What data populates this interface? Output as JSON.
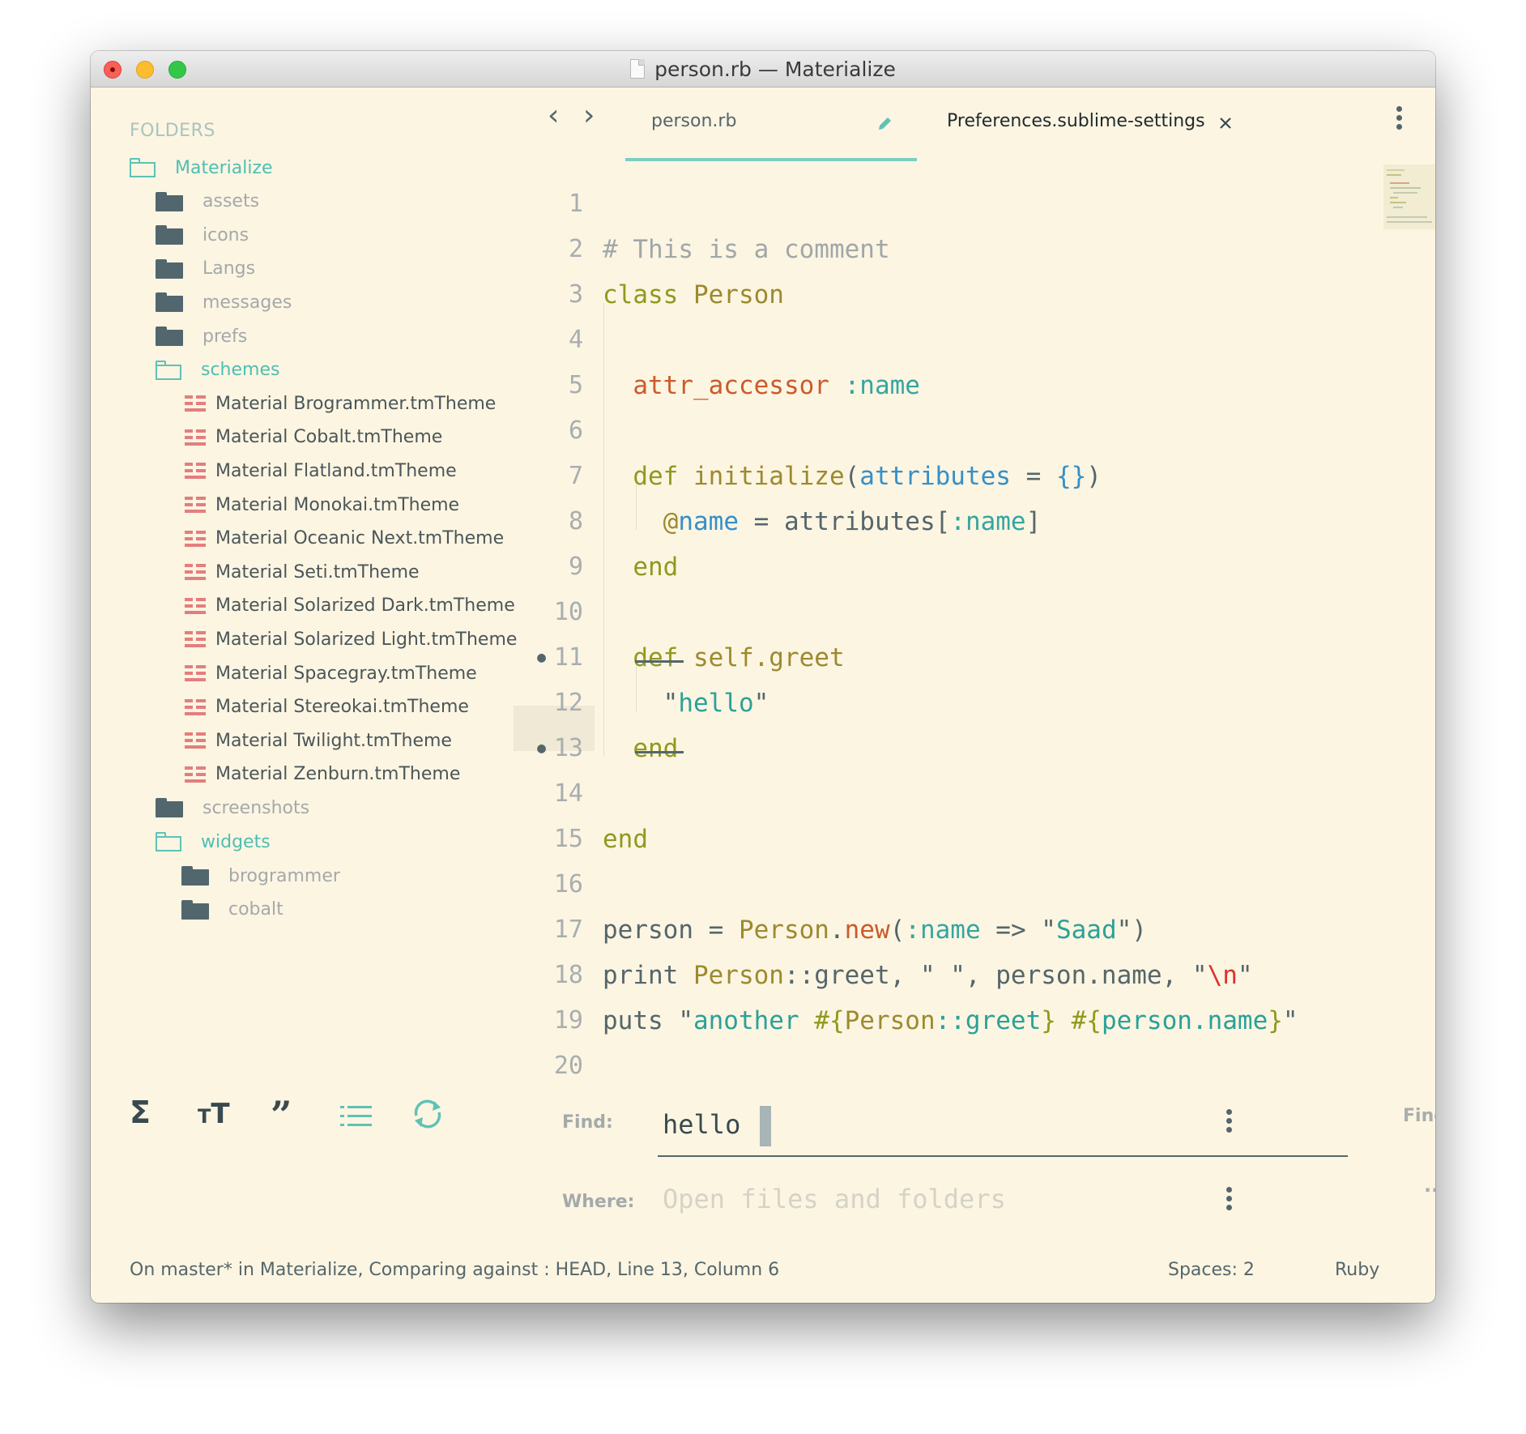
{
  "window": {
    "title": "person.rb — Materialize"
  },
  "sidebar": {
    "header": "FOLDERS",
    "items": [
      {
        "label": "Materialize",
        "kind": "folder-open",
        "depth": 0
      },
      {
        "label": "assets",
        "kind": "folder",
        "depth": 1
      },
      {
        "label": "icons",
        "kind": "folder",
        "depth": 1
      },
      {
        "label": "Langs",
        "kind": "folder",
        "depth": 1
      },
      {
        "label": "messages",
        "kind": "folder",
        "depth": 1
      },
      {
        "label": "prefs",
        "kind": "folder",
        "depth": 1
      },
      {
        "label": "schemes",
        "kind": "folder-open",
        "depth": 1
      },
      {
        "label": "Material Brogrammer.tmTheme",
        "kind": "file",
        "depth": 2
      },
      {
        "label": "Material Cobalt.tmTheme",
        "kind": "file",
        "depth": 2
      },
      {
        "label": "Material Flatland.tmTheme",
        "kind": "file",
        "depth": 2
      },
      {
        "label": "Material Monokai.tmTheme",
        "kind": "file",
        "depth": 2
      },
      {
        "label": "Material Oceanic Next.tmTheme",
        "kind": "file",
        "depth": 2
      },
      {
        "label": "Material Seti.tmTheme",
        "kind": "file",
        "depth": 2
      },
      {
        "label": "Material Solarized Dark.tmTheme",
        "kind": "file",
        "depth": 2
      },
      {
        "label": "Material Solarized Light.tmTheme",
        "kind": "file",
        "depth": 2
      },
      {
        "label": "Material Spacegray.tmTheme",
        "kind": "file",
        "depth": 2
      },
      {
        "label": "Material Stereokai.tmTheme",
        "kind": "file",
        "depth": 2
      },
      {
        "label": "Material Twilight.tmTheme",
        "kind": "file",
        "depth": 2
      },
      {
        "label": "Material Zenburn.tmTheme",
        "kind": "file",
        "depth": 2
      },
      {
        "label": "screenshots",
        "kind": "folder",
        "depth": 1
      },
      {
        "label": "widgets",
        "kind": "folder-open",
        "depth": 1
      },
      {
        "label": "brogrammer",
        "kind": "folder",
        "depth": 2
      },
      {
        "label": "cobalt",
        "kind": "folder",
        "depth": 2
      }
    ]
  },
  "tabs": [
    {
      "label": "person.rb",
      "active": true,
      "icon": "pencil-icon"
    },
    {
      "label": "Preferences.sublime-settings",
      "active": false,
      "icon": "close-icon"
    }
  ],
  "editor": {
    "line_numbers": [
      "1",
      "2",
      "3",
      "4",
      "5",
      "6",
      "7",
      "8",
      "9",
      "10",
      "11",
      "12",
      "13",
      "14",
      "15",
      "16",
      "17",
      "18",
      "19",
      "20"
    ],
    "modified_lines": [
      "11",
      "13"
    ],
    "current_line": "13",
    "lines": [
      [],
      [
        [
          "# This is a comment",
          "comment"
        ]
      ],
      [
        [
          "class ",
          "kw"
        ],
        [
          "Person",
          "cls"
        ]
      ],
      [],
      [
        [
          "  ",
          ""
        ],
        [
          "attr_accessor",
          "red"
        ],
        [
          " ",
          ""
        ],
        [
          ":name",
          "sym"
        ]
      ],
      [],
      [
        [
          "  ",
          ""
        ],
        [
          "def ",
          "kw"
        ],
        [
          "initialize",
          "cls"
        ],
        [
          "(",
          ""
        ],
        [
          "attributes",
          "blue"
        ],
        [
          " = ",
          ""
        ],
        [
          "{}",
          "blue"
        ],
        [
          ")",
          ""
        ]
      ],
      [
        [
          "    ",
          ""
        ],
        [
          "@",
          "cls"
        ],
        [
          "name",
          "blue"
        ],
        [
          " = attributes[",
          ""
        ],
        [
          ":name",
          "sym"
        ],
        [
          "]",
          ""
        ]
      ],
      [
        [
          "  ",
          ""
        ],
        [
          "end",
          "kw"
        ]
      ],
      [],
      [
        [
          "  ",
          ""
        ],
        [
          "def ",
          "kw"
        ],
        [
          "self.greet",
          "cls"
        ]
      ],
      [
        [
          "    \"",
          ""
        ],
        [
          "hello",
          "str"
        ],
        [
          "\"",
          ""
        ]
      ],
      [
        [
          "  ",
          ""
        ],
        [
          "end",
          "kw"
        ]
      ],
      [],
      [
        [
          "end",
          "kw"
        ]
      ],
      [],
      [
        [
          "person = ",
          ""
        ],
        [
          "Person",
          "cls"
        ],
        [
          ".",
          ""
        ],
        [
          "new",
          "red"
        ],
        [
          "(",
          ""
        ],
        [
          ":name",
          "sym"
        ],
        [
          " => \"",
          ""
        ],
        [
          "Saad",
          "str"
        ],
        [
          "\")",
          ""
        ]
      ],
      [
        [
          "print ",
          ""
        ],
        [
          "Person",
          "cls"
        ],
        [
          "::greet, \" \", person.name, \"",
          ""
        ],
        [
          "\\n",
          "esc"
        ],
        [
          "\"",
          ""
        ]
      ],
      [
        [
          "puts \"",
          ""
        ],
        [
          "another ",
          "str"
        ],
        [
          "#{",
          "kw"
        ],
        [
          "Person",
          "cls"
        ],
        [
          "::greet",
          "str"
        ],
        [
          "}",
          "kw"
        ],
        [
          " ",
          ""
        ],
        [
          "#{",
          "kw"
        ],
        [
          "person.name",
          "str"
        ],
        [
          "}",
          "kw"
        ],
        [
          "\"",
          ""
        ]
      ],
      []
    ]
  },
  "find_panel": {
    "find_label": "Find:",
    "find_value": "hello",
    "where_label": "Where:",
    "where_placeholder": "Open files and folders",
    "find_button": "Find",
    "where_button": "...",
    "toggle_icons": [
      "regex-sigma-icon",
      "case-sensitive-icon",
      "whole-word-quote-icon",
      "show-context-list-icon",
      "use-buffer-refresh-icon"
    ]
  },
  "status_bar": {
    "left": "On master* in Materialize, Comparing against : HEAD, Line 13, Column 6",
    "spaces": "Spaces: 2",
    "syntax": "Ruby"
  },
  "colors": {
    "background": "#fcf5e2",
    "accent": "#4fbeb2",
    "file_icon": "#e47e7e",
    "folder_icon": "#52666e"
  }
}
